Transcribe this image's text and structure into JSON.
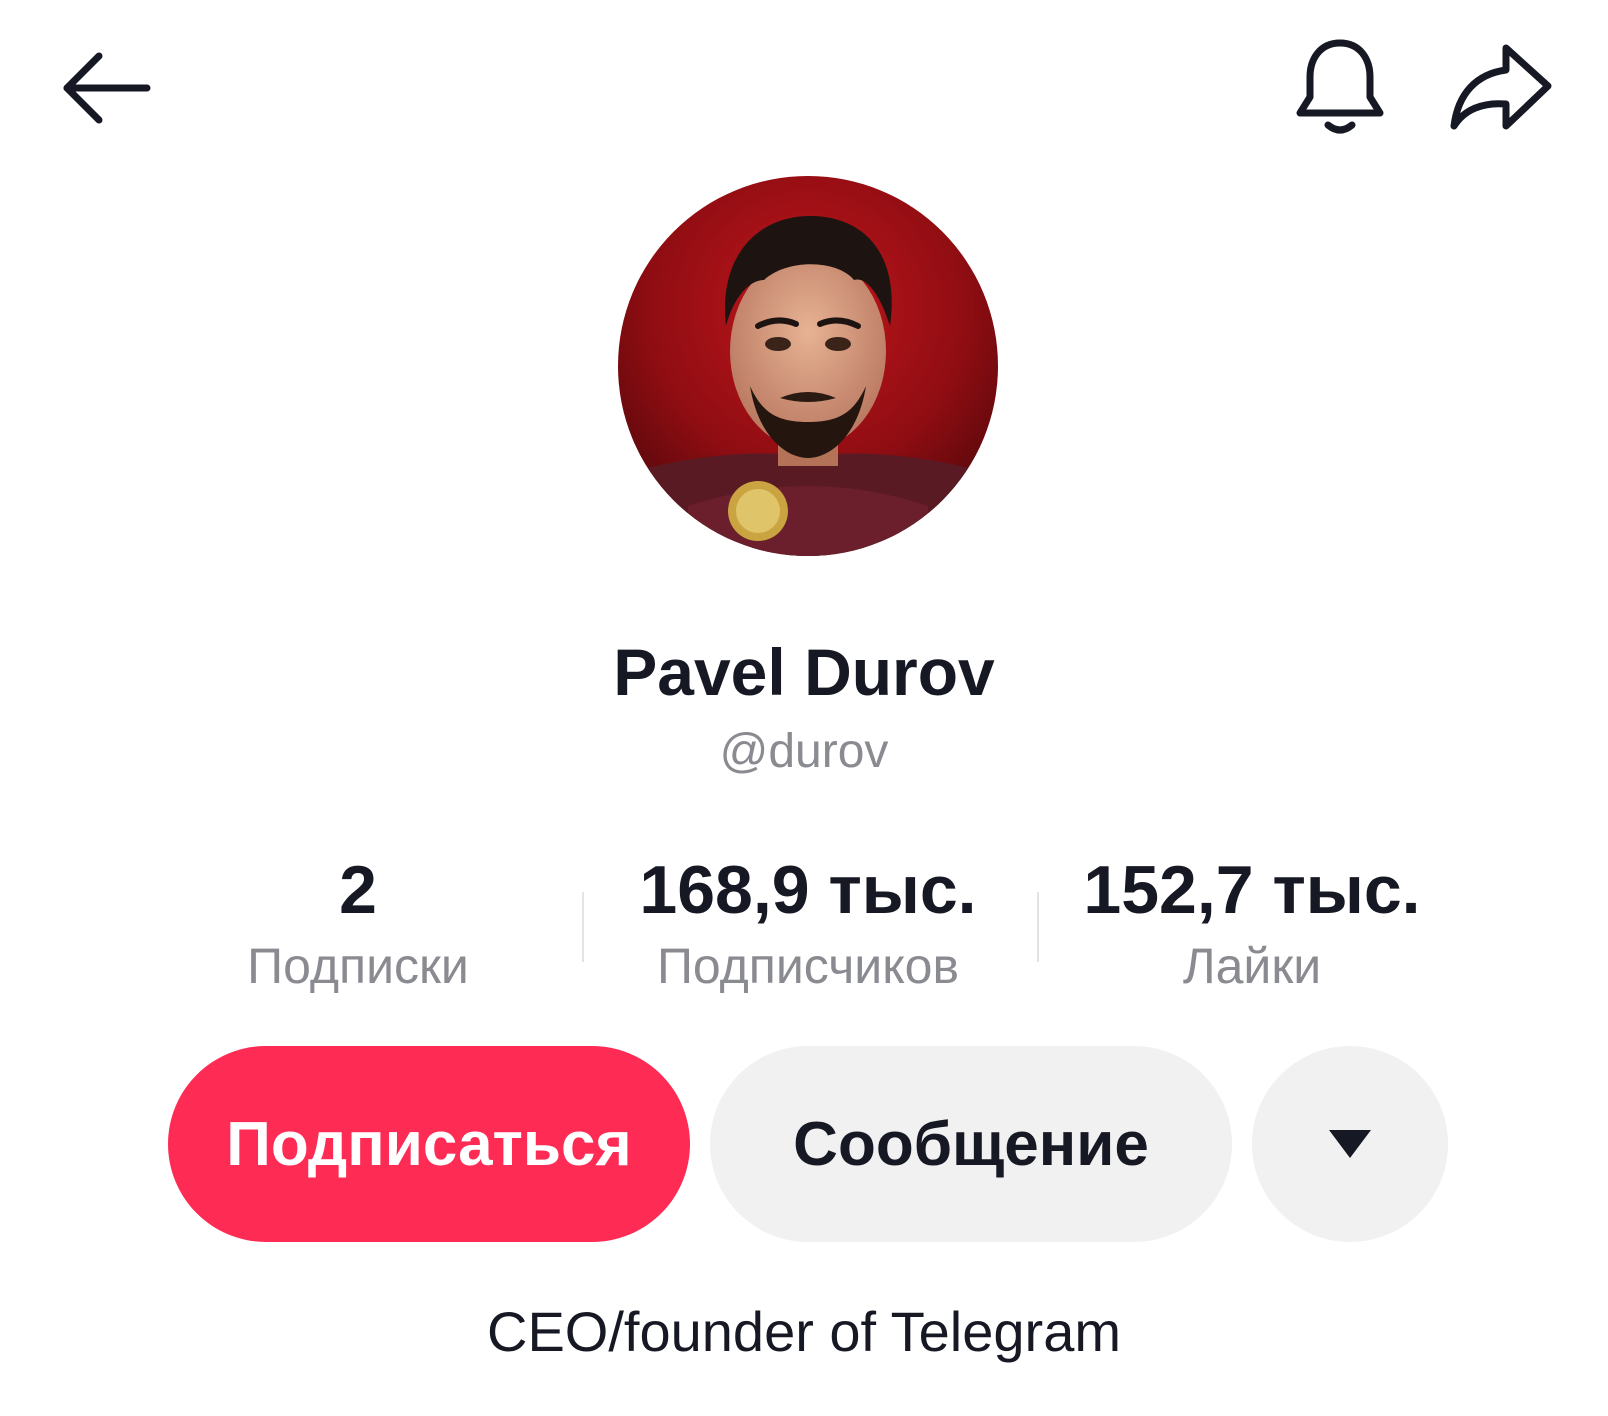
{
  "header": {
    "back_icon": "arrow-left-icon",
    "notifications_icon": "bell-icon",
    "share_icon": "share-arrow-icon"
  },
  "profile": {
    "avatar_icon": "profile-photo",
    "display_name": "Pavel Durov",
    "username": "@durov",
    "bio": "CEO/founder of Telegram"
  },
  "stats": [
    {
      "value": "2",
      "label": "Подписки"
    },
    {
      "value": "168,9 тыс.",
      "label": "Подписчиков"
    },
    {
      "value": "152,7 тыс.",
      "label": "Лайки"
    }
  ],
  "actions": {
    "follow_label": "Подписаться",
    "message_label": "Сообщение",
    "more_icon": "caret-down-icon"
  },
  "colors": {
    "accent": "#fe2c55",
    "secondary_button": "#f1f1f2",
    "muted_text": "#8a8b91",
    "primary_text": "#161823"
  }
}
